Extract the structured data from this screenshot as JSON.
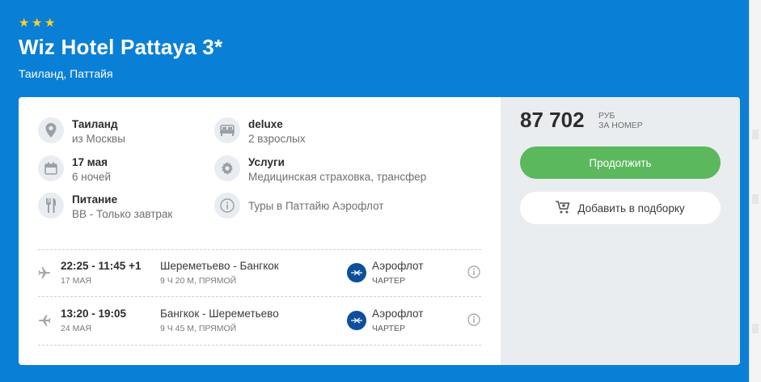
{
  "hotel": {
    "stars": [
      "★",
      "★",
      "★"
    ],
    "title": "Wiz Hotel Pattaya 3*",
    "location": "Таиланд, Паттайя"
  },
  "details": [
    {
      "icon": "location-pin-icon",
      "title": "Таиланд",
      "subtitle": "из Москвы"
    },
    {
      "icon": "bed-icon",
      "title": "deluxe",
      "subtitle": "2 взрослых"
    },
    {
      "icon": "calendar-icon",
      "title": "17 мая",
      "subtitle": "6 ночей"
    },
    {
      "icon": "gear-icon",
      "title": "Услуги",
      "subtitle": "Медицинская страховка, трансфер"
    },
    {
      "icon": "fork-knife-icon",
      "title": "Питание",
      "subtitle": "BB - Только завтрак"
    },
    {
      "icon": "info-icon",
      "title": "",
      "subtitle": "Туры в Паттайю Аэрофлот"
    }
  ],
  "flights": [
    {
      "times": "22:25 - 11:45 +1",
      "date": "17 МАЯ",
      "route": "Шереметьево - Бангкок",
      "duration": "9 Ч 20 М, ПРЯМОЙ",
      "airline": "Аэрофлот",
      "charter": "ЧАРТЕР"
    },
    {
      "times": "13:20 - 19:05",
      "date": "24 МАЯ",
      "route": "Бангкок - Шереметьево",
      "duration": "9 Ч 45 М, ПРЯМОЙ",
      "airline": "Аэрофлот",
      "charter": "ЧАРТЕР"
    }
  ],
  "pricing": {
    "price": "87 702",
    "currency": "РУБ",
    "per": "ЗА НОМЕР",
    "continue_label": "Продолжить",
    "add_label": "Добавить в подборку"
  },
  "colors": {
    "background": "#0a7fd6",
    "star": "#ffd21f",
    "continue_button": "#5cb85c",
    "side_panel": "#eaedf0",
    "airline_logo": "#0e4f9b"
  }
}
